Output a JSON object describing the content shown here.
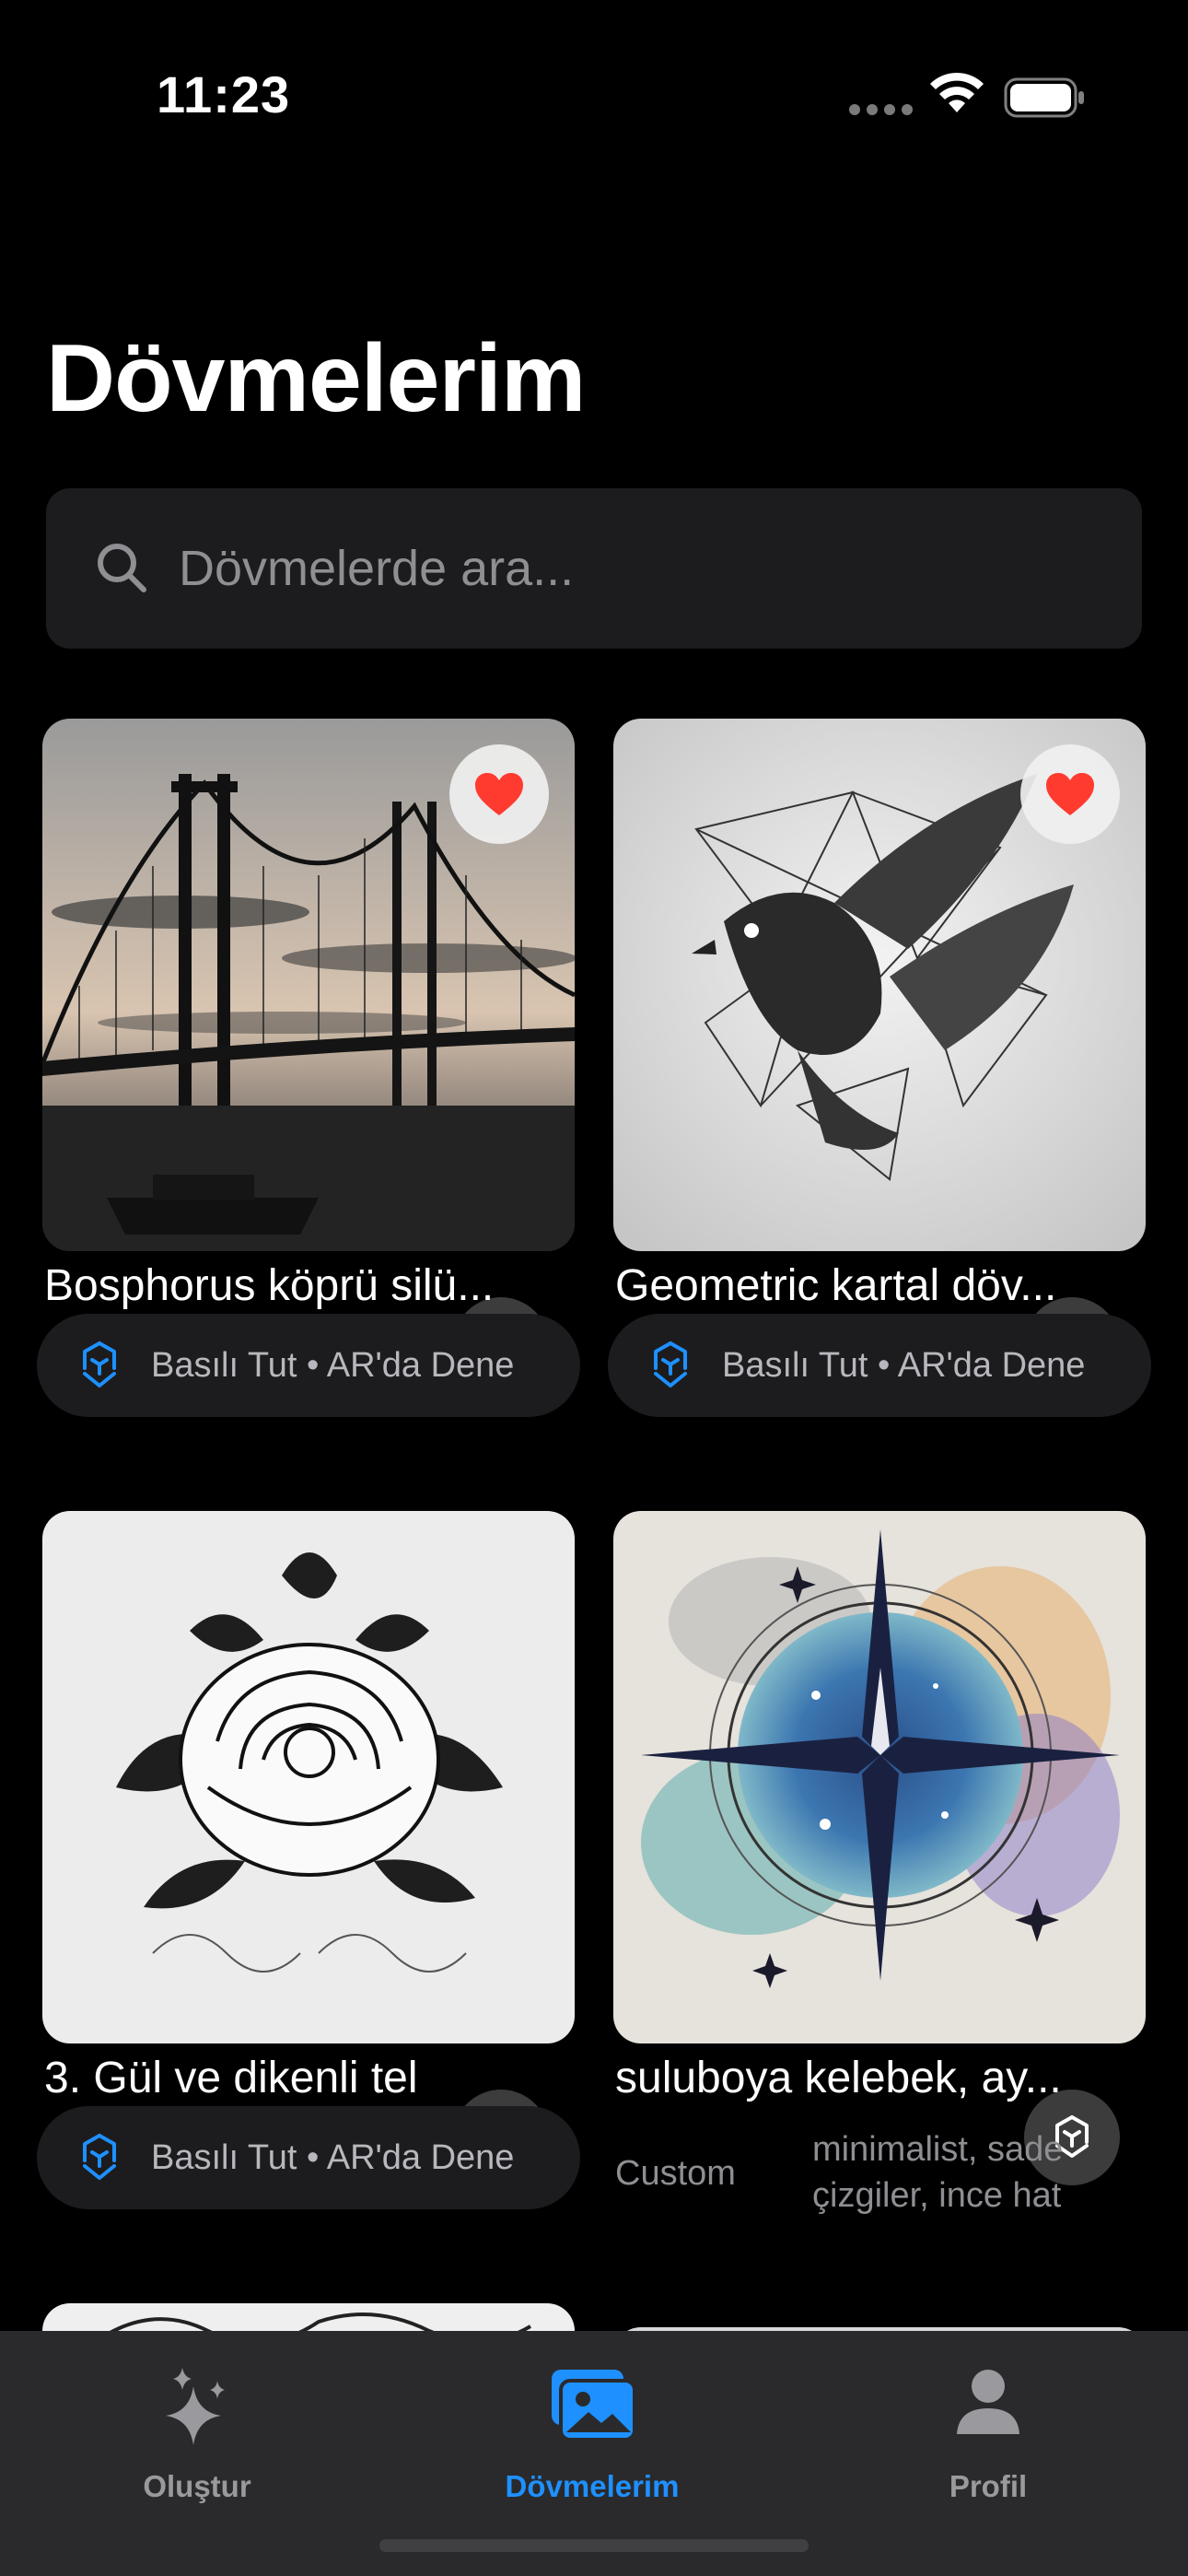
{
  "status_bar": {
    "time": "11:23"
  },
  "page": {
    "title": "Dövmelerim"
  },
  "search": {
    "placeholder": "Dövmelerde ara..."
  },
  "cards": [
    {
      "title": "Bosphorus köprü silü...",
      "favorite": true,
      "ar_hint": "Basılı Tut • AR'da Dene"
    },
    {
      "title": "Geometric kartal döv...",
      "favorite": true,
      "ar_hint": "Basılı Tut • AR'da Dene"
    },
    {
      "title": "3. Gül ve dikenli tel",
      "favorite": false,
      "ar_hint": "Basılı Tut • AR'da Dene"
    },
    {
      "title": "suluboya kelebek, ay...",
      "favorite": false,
      "style": "Custom",
      "details": "minimalist, sade çizgiler, ince hat"
    }
  ],
  "tab_bar": {
    "tabs": [
      {
        "label": "Oluştur",
        "icon": "sparkles-icon",
        "active": false
      },
      {
        "label": "Dövmelerim",
        "icon": "photos-icon",
        "active": true
      },
      {
        "label": "Profil",
        "icon": "person-icon",
        "active": false
      }
    ]
  },
  "colors": {
    "accent": "#1e90ff",
    "favorite": "#ff3b30",
    "background": "#000000",
    "card_bg": "#1c1c1e"
  }
}
